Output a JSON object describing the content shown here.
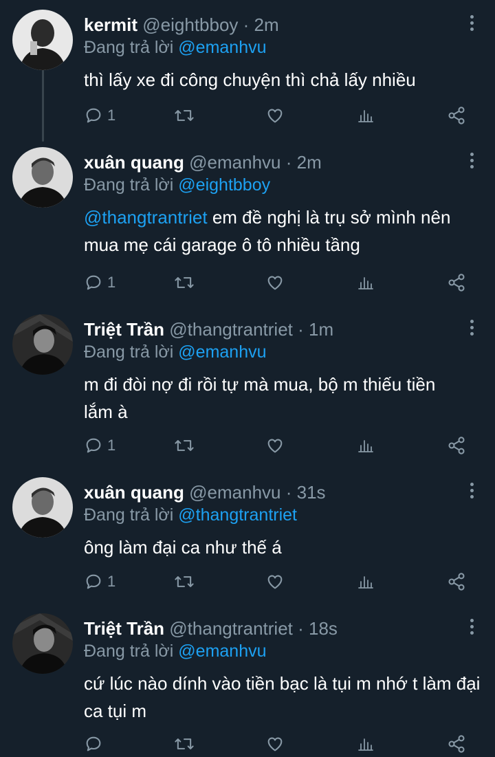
{
  "tweets": [
    {
      "name": "kermit",
      "handle": "@eightbboy",
      "time": "· 2m",
      "replying_prefix": "Đang trả lời",
      "replying_to": "@emanhvu",
      "mention": "",
      "text": "thì lấy xe đi công chuyện thì chả lấy nhiều",
      "reply_count": "1"
    },
    {
      "name": "xuân quang",
      "handle": "@emanhvu",
      "time": "· 2m",
      "replying_prefix": "Đang trả lời",
      "replying_to": "@eightbboy",
      "mention": "@thangtrantriet",
      "text": " em đề nghị là trụ sở mình nên mua mẹ cái garage ô tô nhiều tầng",
      "reply_count": "1"
    },
    {
      "name": "Triệt Trần",
      "handle": "@thangtrantriet",
      "time": "· 1m",
      "replying_prefix": "Đang trả lời",
      "replying_to": "@emanhvu",
      "mention": "",
      "text": "m đi đòi nợ đi rồi tự mà mua, bộ m thiếu tiền lắm à",
      "reply_count": "1"
    },
    {
      "name": "xuân quang",
      "handle": "@emanhvu",
      "time": "· 31s",
      "replying_prefix": "Đang trả lời",
      "replying_to": "@thangtrantriet",
      "mention": "",
      "text": "ông làm đại ca như thế á",
      "reply_count": "1"
    },
    {
      "name": "Triệt Trần",
      "handle": "@thangtrantriet",
      "time": "· 18s",
      "replying_prefix": "Đang trả lời",
      "replying_to": "@emanhvu",
      "mention": "",
      "text": "cứ lúc nào dính vào tiền bạc là tụi m nhớ t làm đại ca tụi m",
      "reply_count": ""
    }
  ],
  "colors": {
    "background": "#15202b",
    "secondary_text": "#8899a6",
    "link": "#1da1f2",
    "thread_line": "#38444d"
  },
  "icons": [
    "reply-icon",
    "retweet-icon",
    "like-icon",
    "analytics-icon",
    "share-icon",
    "more-icon"
  ]
}
